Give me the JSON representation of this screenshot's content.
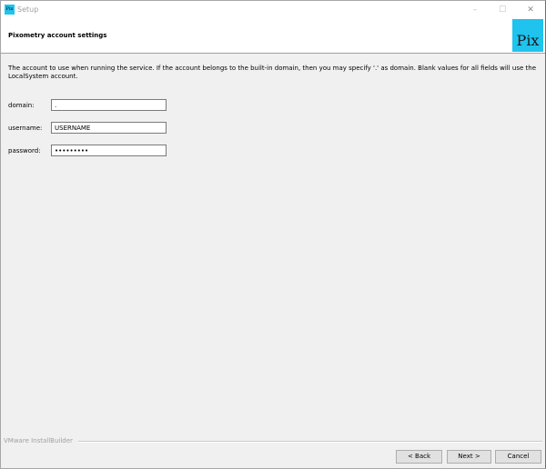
{
  "window": {
    "title": "Setup",
    "app_icon_text": "Pix",
    "controls": {
      "minimize": "–",
      "maximize": "☐",
      "close": "✕"
    }
  },
  "header": {
    "title": "Pixometry account settings",
    "logo_text": "Pix",
    "logo_color": "#1fc3ee"
  },
  "content": {
    "description": "The account to use when running the service. If the account belongs to the built-in domain, then you may specify '.' as domain. Blank values for all fields will use the LocalSystem account.",
    "fields": {
      "domain": {
        "label": "domain:",
        "value": "."
      },
      "username": {
        "label": "username:",
        "value": "USERNAME"
      },
      "password": {
        "label": "password:",
        "value": "•••••••••"
      }
    }
  },
  "footer": {
    "brand": "VMware InstallBuilder",
    "back_label": "< Back",
    "next_label": "Next >",
    "cancel_label": "Cancel"
  }
}
